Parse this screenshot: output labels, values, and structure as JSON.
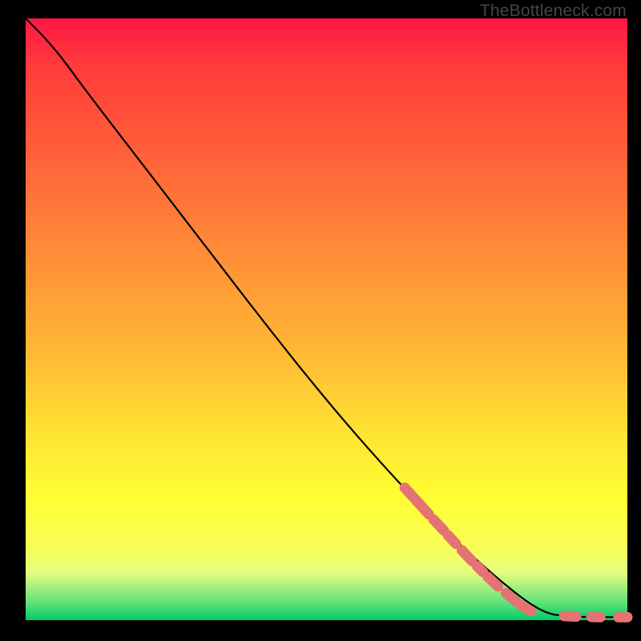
{
  "attribution": "TheBottleneck.com",
  "chart_data": {
    "type": "line",
    "title": "",
    "xlabel": "",
    "ylabel": "",
    "xlim": [
      0,
      100
    ],
    "ylim": [
      0,
      100
    ],
    "curve": [
      {
        "x": 0,
        "y": 100
      },
      {
        "x": 3,
        "y": 97
      },
      {
        "x": 6,
        "y": 93.5
      },
      {
        "x": 10,
        "y": 88
      },
      {
        "x": 20,
        "y": 75
      },
      {
        "x": 30,
        "y": 62
      },
      {
        "x": 40,
        "y": 49
      },
      {
        "x": 50,
        "y": 36.5
      },
      {
        "x": 60,
        "y": 25
      },
      {
        "x": 70,
        "y": 14.5
      },
      {
        "x": 80,
        "y": 5.5
      },
      {
        "x": 86,
        "y": 1.2
      },
      {
        "x": 90,
        "y": 0.6
      },
      {
        "x": 95,
        "y": 0.5
      },
      {
        "x": 100,
        "y": 0.5
      }
    ],
    "highlight_segments": [
      {
        "x1": 63,
        "y1": 22.0,
        "x2": 65,
        "y2": 19.8
      },
      {
        "x1": 65,
        "y1": 19.8,
        "x2": 67,
        "y2": 17.6
      },
      {
        "x1": 67.8,
        "y1": 16.7,
        "x2": 69.5,
        "y2": 14.9
      },
      {
        "x1": 70.2,
        "y1": 14.1,
        "x2": 71.5,
        "y2": 12.7
      },
      {
        "x1": 72.5,
        "y1": 11.6,
        "x2": 74.2,
        "y2": 9.8
      },
      {
        "x1": 75.0,
        "y1": 9.0,
        "x2": 76.0,
        "y2": 8.0
      },
      {
        "x1": 76.8,
        "y1": 7.2,
        "x2": 78.5,
        "y2": 5.6
      },
      {
        "x1": 79.8,
        "y1": 4.5,
        "x2": 81.5,
        "y2": 3.1
      },
      {
        "x1": 82.3,
        "y1": 2.5,
        "x2": 84.0,
        "y2": 1.5
      },
      {
        "x1": 89.5,
        "y1": 0.7,
        "x2": 91.5,
        "y2": 0.6
      },
      {
        "x1": 94.0,
        "y1": 0.55,
        "x2": 95.5,
        "y2": 0.5
      },
      {
        "x1": 98.5,
        "y1": 0.5,
        "x2": 100,
        "y2": 0.5
      }
    ],
    "colors": {
      "curve": "#000000",
      "highlight": "#e57373"
    }
  }
}
